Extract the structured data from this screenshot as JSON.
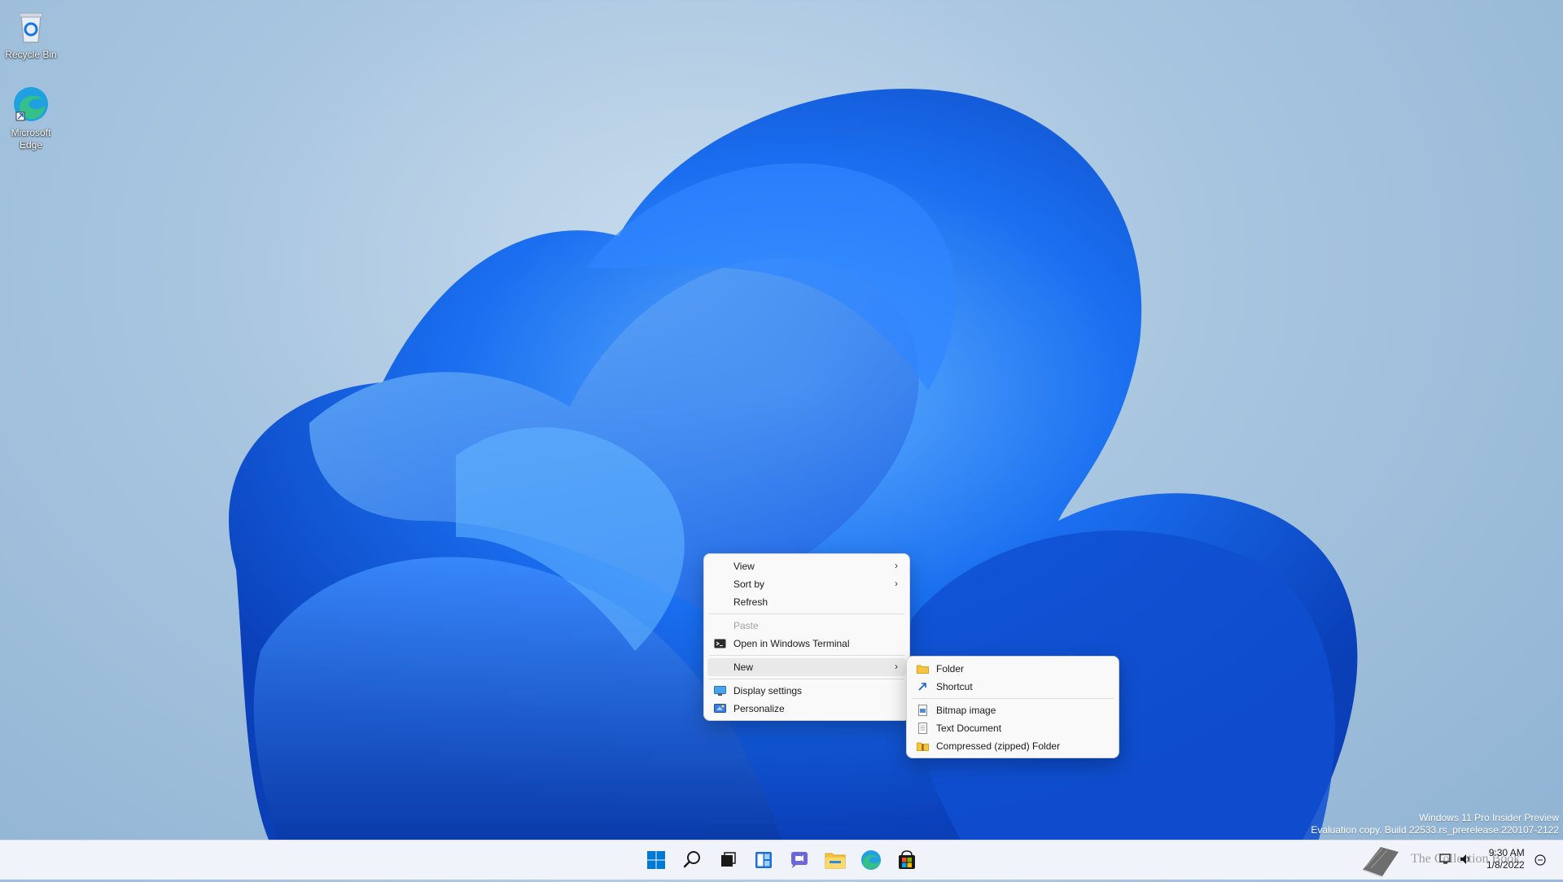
{
  "desktop": {
    "icons": [
      {
        "label": "Recycle Bin"
      },
      {
        "label": "Microsoft Edge"
      }
    ],
    "watermark": {
      "line1": "Windows 11 Pro Insider Preview",
      "line2": "Evaluation copy. Build 22533.rs_prerelease.220107-2122"
    },
    "overlay_text": "The Collection Book"
  },
  "context_menu": {
    "items": [
      "View",
      "Sort by",
      "Refresh",
      "Paste",
      "Open in Windows Terminal",
      "New",
      "Display settings",
      "Personalize"
    ],
    "arrow": "›"
  },
  "new_submenu": {
    "items": [
      "Folder",
      "Shortcut",
      "Bitmap image",
      "Text Document",
      "Compressed (zipped) Folder"
    ]
  },
  "taskbar": {
    "icons": [
      "start-icon",
      "search-icon",
      "task-view-icon",
      "widgets-icon",
      "chat-icon",
      "file-explorer-icon",
      "edge-icon",
      "store-icon"
    ],
    "clock": {
      "time": "9:30 AM",
      "date": "1/8/2022"
    }
  },
  "colors": {
    "accent": "#0067c0",
    "menu_bg": "#f9f9f9",
    "taskbar_bg": "#f0f3f9"
  }
}
